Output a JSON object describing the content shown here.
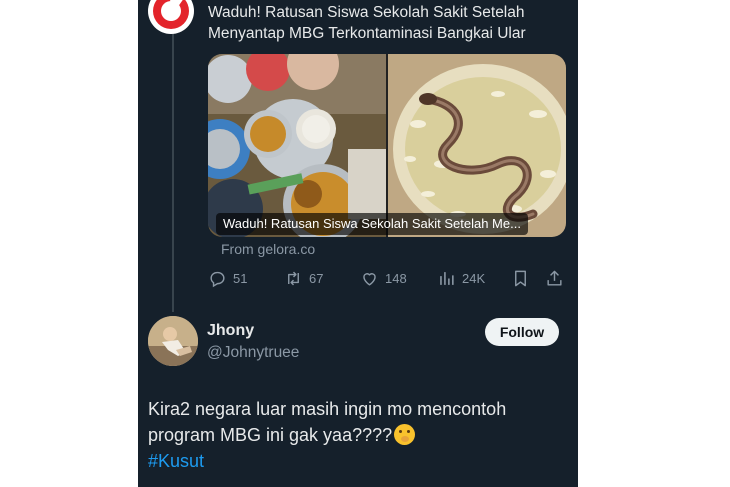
{
  "source_card": {
    "logo_icon": "source-logo-icon",
    "headline_line1": "Waduh! Ratusan Siswa Sekolah Sakit Setelah",
    "headline_line2": "Menyantap MBG Terkontaminasi Bangkai Ular",
    "media_caption": "Waduh! Ratusan Siswa Sekolah Sakit Setelah Me...",
    "from_source": "From gelora.co"
  },
  "actions": {
    "replies": "51",
    "reposts": "67",
    "likes": "148",
    "views": "24K",
    "reply_icon": "reply-icon",
    "repost_icon": "repost-icon",
    "like_icon": "heart-icon",
    "views_icon": "views-icon",
    "bookmark_icon": "bookmark-icon",
    "share_icon": "share-icon"
  },
  "author": {
    "name": "Jhony",
    "handle": "@Johnytruee",
    "follow_label": "Follow"
  },
  "tweet": {
    "line1": "Kira2 negara luar masih ingin mo mencontoh",
    "line2": "program MBG ini gak yaa????",
    "emoji_icon": "face-with-hand-over-mouth-emoji",
    "hashtag": "#Kusut"
  },
  "colors": {
    "background": "#15202b",
    "text": "#e7e9ea",
    "muted": "#8b98a5",
    "link": "#1d9bf0",
    "page": "#ffffff"
  }
}
